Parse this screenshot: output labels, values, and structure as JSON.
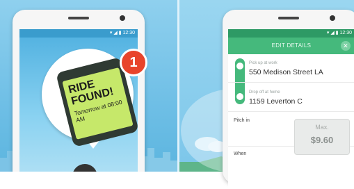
{
  "left_screen": {
    "status_time": "12:30",
    "notification_count": "1",
    "ride_found": "RIDE FOUND!",
    "schedule_text": "Tomorrow at 08:00 AM"
  },
  "right_screen": {
    "status_time": "12:30",
    "title": "EDIT DETAILS",
    "pickup_label": "Pick up at work",
    "pickup_address": "550 Medison Street LA",
    "dropoff_label": "Drop off at home",
    "dropoff_address": "1159 Leverton C",
    "pitch_label": "Pitch in",
    "when_label": "When",
    "max_label": "Max.",
    "max_value": "$9.60"
  },
  "colors": {
    "accent_green": "#45b97c",
    "badge_red": "#e8442b",
    "card_green": "#c6e86a"
  }
}
